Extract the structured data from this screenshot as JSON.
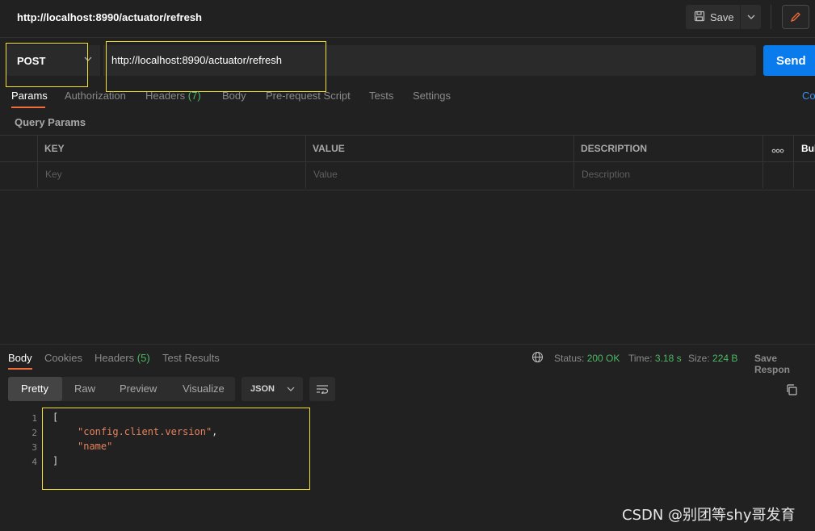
{
  "header": {
    "title": "http://localhost:8990/actuator/refresh",
    "save_label": "Save"
  },
  "request": {
    "method": "POST",
    "url": "http://localhost:8990/actuator/refresh",
    "send_label": "Send"
  },
  "tabs": {
    "params": "Params",
    "authorization": "Authorization",
    "headers": "Headers",
    "headers_count": "(7)",
    "body": "Body",
    "prerequest": "Pre-request Script",
    "tests": "Tests",
    "settings": "Settings",
    "cookies_link": "Co"
  },
  "params": {
    "section_label": "Query Params",
    "columns": [
      "KEY",
      "VALUE",
      "DESCRIPTION"
    ],
    "bulk_label": "Bul",
    "placeholders": [
      "Key",
      "Value",
      "Description"
    ]
  },
  "response": {
    "tabs": {
      "body": "Body",
      "cookies": "Cookies",
      "headers": "Headers",
      "headers_count": "(5)",
      "test_results": "Test Results"
    },
    "status_label": "Status:",
    "status_value": "200 OK",
    "time_label": "Time:",
    "time_value": "3.18 s",
    "size_label": "Size:",
    "size_value": "224 B",
    "save_response": "Save Respon",
    "view_modes": [
      "Pretty",
      "Raw",
      "Preview",
      "Visualize"
    ],
    "format": "JSON",
    "code": {
      "line_numbers": [
        "1",
        "2",
        "3",
        "4"
      ],
      "open": "[",
      "item1": "\"config.client.version\"",
      "comma": ",",
      "item2": "\"name\"",
      "close": "]"
    }
  },
  "watermark": "CSDN @别团等shy哥发育",
  "colors": {
    "accent": "#097bed",
    "tab_underline": "#f26b3a",
    "status_ok": "#4cb963",
    "highlight_box": "#f2e02a"
  }
}
